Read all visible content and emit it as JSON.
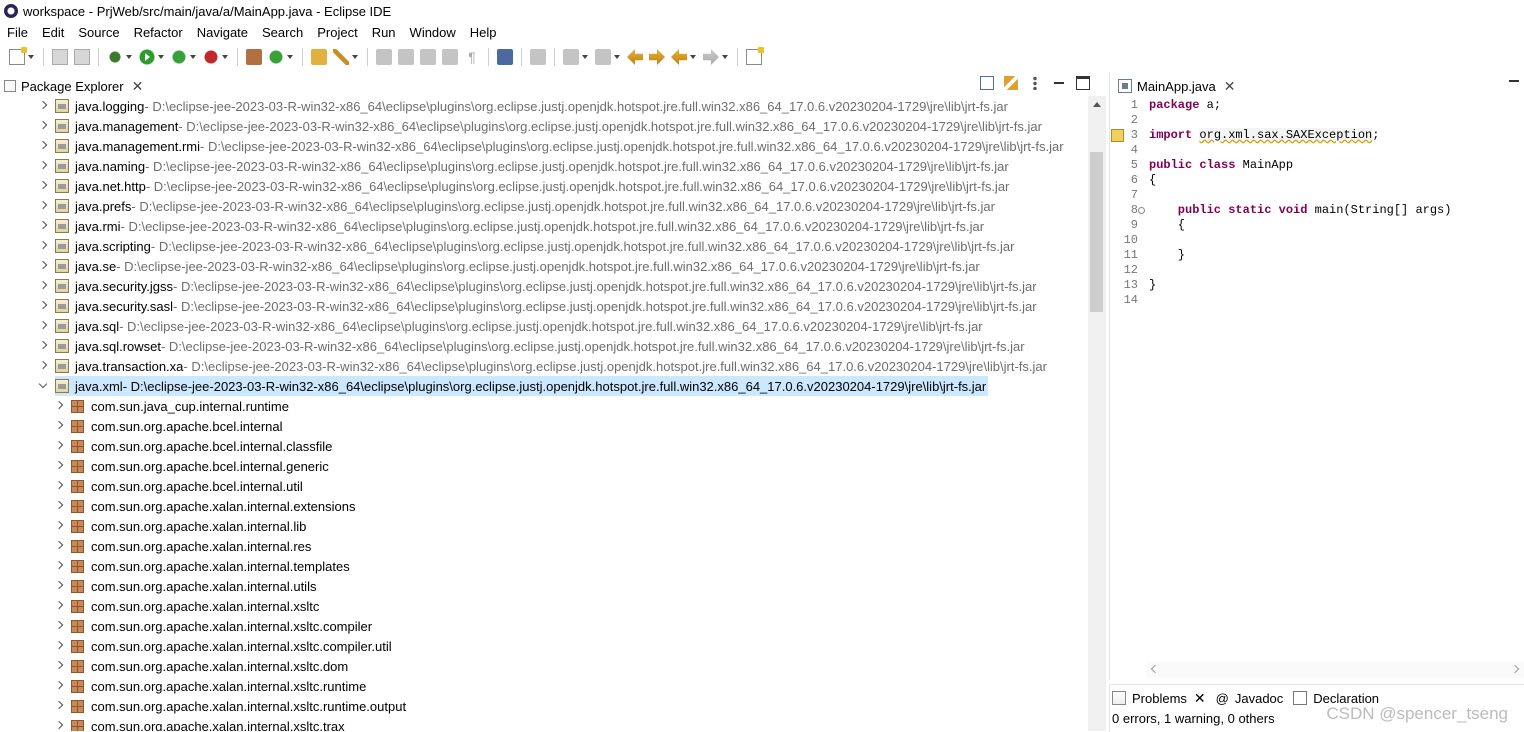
{
  "window": {
    "title": "workspace - PrjWeb/src/main/java/a/MainApp.java - Eclipse IDE"
  },
  "menu": [
    "File",
    "Edit",
    "Source",
    "Refactor",
    "Navigate",
    "Search",
    "Project",
    "Run",
    "Window",
    "Help"
  ],
  "package_explorer": {
    "tab_label": "Package Explorer",
    "rows": [
      {
        "name": "java.logging",
        "path": " - D:\\eclipse-jee-2023-03-R-win32-x86_64\\eclipse\\plugins\\org.eclipse.justj.openjdk.hotspot.jre.full.win32.x86_64_17.0.6.v20230204-1729\\jre\\lib\\jrt-fs.jar"
      },
      {
        "name": "java.management",
        "path": " - D:\\eclipse-jee-2023-03-R-win32-x86_64\\eclipse\\plugins\\org.eclipse.justj.openjdk.hotspot.jre.full.win32.x86_64_17.0.6.v20230204-1729\\jre\\lib\\jrt-fs.jar"
      },
      {
        "name": "java.management.rmi",
        "path": " - D:\\eclipse-jee-2023-03-R-win32-x86_64\\eclipse\\plugins\\org.eclipse.justj.openjdk.hotspot.jre.full.win32.x86_64_17.0.6.v20230204-1729\\jre\\lib\\jrt-fs.jar"
      },
      {
        "name": "java.naming",
        "path": " - D:\\eclipse-jee-2023-03-R-win32-x86_64\\eclipse\\plugins\\org.eclipse.justj.openjdk.hotspot.jre.full.win32.x86_64_17.0.6.v20230204-1729\\jre\\lib\\jrt-fs.jar"
      },
      {
        "name": "java.net.http",
        "path": " - D:\\eclipse-jee-2023-03-R-win32-x86_64\\eclipse\\plugins\\org.eclipse.justj.openjdk.hotspot.jre.full.win32.x86_64_17.0.6.v20230204-1729\\jre\\lib\\jrt-fs.jar"
      },
      {
        "name": "java.prefs",
        "path": " - D:\\eclipse-jee-2023-03-R-win32-x86_64\\eclipse\\plugins\\org.eclipse.justj.openjdk.hotspot.jre.full.win32.x86_64_17.0.6.v20230204-1729\\jre\\lib\\jrt-fs.jar"
      },
      {
        "name": "java.rmi",
        "path": " - D:\\eclipse-jee-2023-03-R-win32-x86_64\\eclipse\\plugins\\org.eclipse.justj.openjdk.hotspot.jre.full.win32.x86_64_17.0.6.v20230204-1729\\jre\\lib\\jrt-fs.jar"
      },
      {
        "name": "java.scripting",
        "path": " - D:\\eclipse-jee-2023-03-R-win32-x86_64\\eclipse\\plugins\\org.eclipse.justj.openjdk.hotspot.jre.full.win32.x86_64_17.0.6.v20230204-1729\\jre\\lib\\jrt-fs.jar"
      },
      {
        "name": "java.se",
        "path": " - D:\\eclipse-jee-2023-03-R-win32-x86_64\\eclipse\\plugins\\org.eclipse.justj.openjdk.hotspot.jre.full.win32.x86_64_17.0.6.v20230204-1729\\jre\\lib\\jrt-fs.jar"
      },
      {
        "name": "java.security.jgss",
        "path": " - D:\\eclipse-jee-2023-03-R-win32-x86_64\\eclipse\\plugins\\org.eclipse.justj.openjdk.hotspot.jre.full.win32.x86_64_17.0.6.v20230204-1729\\jre\\lib\\jrt-fs.jar"
      },
      {
        "name": "java.security.sasl",
        "path": " - D:\\eclipse-jee-2023-03-R-win32-x86_64\\eclipse\\plugins\\org.eclipse.justj.openjdk.hotspot.jre.full.win32.x86_64_17.0.6.v20230204-1729\\jre\\lib\\jrt-fs.jar"
      },
      {
        "name": "java.sql",
        "path": " - D:\\eclipse-jee-2023-03-R-win32-x86_64\\eclipse\\plugins\\org.eclipse.justj.openjdk.hotspot.jre.full.win32.x86_64_17.0.6.v20230204-1729\\jre\\lib\\jrt-fs.jar"
      },
      {
        "name": "java.sql.rowset",
        "path": " - D:\\eclipse-jee-2023-03-R-win32-x86_64\\eclipse\\plugins\\org.eclipse.justj.openjdk.hotspot.jre.full.win32.x86_64_17.0.6.v20230204-1729\\jre\\lib\\jrt-fs.jar"
      },
      {
        "name": "java.transaction.xa",
        "path": " - D:\\eclipse-jee-2023-03-R-win32-x86_64\\eclipse\\plugins\\org.eclipse.justj.openjdk.hotspot.jre.full.win32.x86_64_17.0.6.v20230204-1729\\jre\\lib\\jrt-fs.jar"
      },
      {
        "name": "java.xml",
        "path": " - D:\\eclipse-jee-2023-03-R-win32-x86_64\\eclipse\\plugins\\org.eclipse.justj.openjdk.hotspot.jre.full.win32.x86_64_17.0.6.v20230204-1729\\jre\\lib\\jrt-fs.jar"
      }
    ],
    "packages": [
      "com.sun.java_cup.internal.runtime",
      "com.sun.org.apache.bcel.internal",
      "com.sun.org.apache.bcel.internal.classfile",
      "com.sun.org.apache.bcel.internal.generic",
      "com.sun.org.apache.bcel.internal.util",
      "com.sun.org.apache.xalan.internal.extensions",
      "com.sun.org.apache.xalan.internal.lib",
      "com.sun.org.apache.xalan.internal.res",
      "com.sun.org.apache.xalan.internal.templates",
      "com.sun.org.apache.xalan.internal.utils",
      "com.sun.org.apache.xalan.internal.xsltc",
      "com.sun.org.apache.xalan.internal.xsltc.compiler",
      "com.sun.org.apache.xalan.internal.xsltc.compiler.util",
      "com.sun.org.apache.xalan.internal.xsltc.dom",
      "com.sun.org.apache.xalan.internal.xsltc.runtime",
      "com.sun.org.apache.xalan.internal.xsltc.runtime.output",
      "com.sun.org.apache.xalan.internal.xsltc.trax"
    ]
  },
  "editor": {
    "tab_label": "MainApp.java",
    "line_numbers": [
      "1",
      "2",
      "3",
      "4",
      "5",
      "6",
      "7",
      "8",
      "9",
      "10",
      "11",
      "12",
      "13",
      "14"
    ],
    "lines": [
      {
        "kw": "package",
        "rest": " a;"
      },
      {
        "kw": "",
        "rest": ""
      },
      {
        "kw": "import",
        "rest": " ",
        "warn": "org.xml.sax.SAXException",
        "after": ";"
      },
      {
        "kw": "",
        "rest": ""
      },
      {
        "kw": "public class",
        "rest": " MainApp"
      },
      {
        "kw": "",
        "rest": "{"
      },
      {
        "kw": "",
        "rest": ""
      },
      {
        "kw": "    public static void",
        "rest": " main(String[] args)"
      },
      {
        "kw": "",
        "rest": "    {"
      },
      {
        "kw": "",
        "rest": ""
      },
      {
        "kw": "",
        "rest": "    }"
      },
      {
        "kw": "",
        "rest": ""
      },
      {
        "kw": "",
        "rest": "}"
      },
      {
        "kw": "",
        "rest": ""
      }
    ]
  },
  "problems": {
    "tabs": [
      "Problems",
      "Javadoc",
      "Declaration"
    ],
    "status": "0 errors, 1 warning, 0 others"
  },
  "watermark": "CSDN @spencer_tseng"
}
